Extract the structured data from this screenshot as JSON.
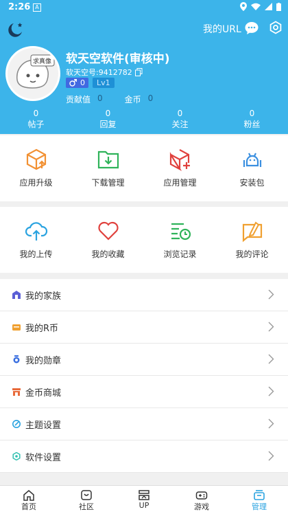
{
  "status": {
    "time": "2:26",
    "a_badge": "A"
  },
  "header": {
    "my_url_label": "我的URL",
    "username": "软天空软件(审核中)",
    "user_id": "软天空号:9412782",
    "gender_count": "0",
    "level": "Lv1",
    "avatar_text": "求真像",
    "contribution_label": "贡献值",
    "contribution_value": "0",
    "coins_label": "金币",
    "coins_value": "0"
  },
  "stats": [
    {
      "value": "0",
      "label": "帖子"
    },
    {
      "value": "0",
      "label": "回复"
    },
    {
      "value": "0",
      "label": "关注"
    },
    {
      "value": "0",
      "label": "粉丝"
    }
  ],
  "grid1": [
    {
      "label": "应用升级",
      "icon": "app-upgrade-icon",
      "color": "#f29133"
    },
    {
      "label": "下载管理",
      "icon": "download-folder-icon",
      "color": "#2fb35a"
    },
    {
      "label": "应用管理",
      "icon": "app-manage-icon",
      "color": "#e0413d"
    },
    {
      "label": "安装包",
      "icon": "android-package-icon",
      "color": "#3a8fe0"
    }
  ],
  "grid2": [
    {
      "label": "我的上传",
      "icon": "cloud-upload-icon",
      "color": "#2aa3e0"
    },
    {
      "label": "我的收藏",
      "icon": "heart-icon",
      "color": "#e0413d"
    },
    {
      "label": "浏览记录",
      "icon": "history-icon",
      "color": "#2fb35a"
    },
    {
      "label": "我的评论",
      "icon": "comment-icon",
      "color": "#f0a030"
    }
  ],
  "menu": [
    {
      "label": "我的家族",
      "icon": "family-icon",
      "color": "#5b5fd6"
    },
    {
      "label": "我的R币",
      "icon": "rcoin-icon",
      "color": "#f0a030"
    },
    {
      "label": "我的勋章",
      "icon": "medal-icon",
      "color": "#3a6fe0"
    },
    {
      "label": "金币商城",
      "icon": "shop-icon",
      "color": "#e86a3a"
    },
    {
      "label": "主题设置",
      "icon": "theme-icon",
      "color": "#2aa3e0"
    },
    {
      "label": "软件设置",
      "icon": "settings-icon",
      "color": "#30c0b0"
    }
  ],
  "nav": [
    {
      "label": "首页",
      "icon": "home-icon"
    },
    {
      "label": "社区",
      "icon": "community-icon"
    },
    {
      "label": "UP",
      "icon": "up-icon"
    },
    {
      "label": "游戏",
      "icon": "gamepad-icon"
    },
    {
      "label": "管理",
      "icon": "manage-icon",
      "active": true
    }
  ],
  "colors": {
    "header_bg": "#3cb4ea",
    "active": "#2aa3e0"
  }
}
